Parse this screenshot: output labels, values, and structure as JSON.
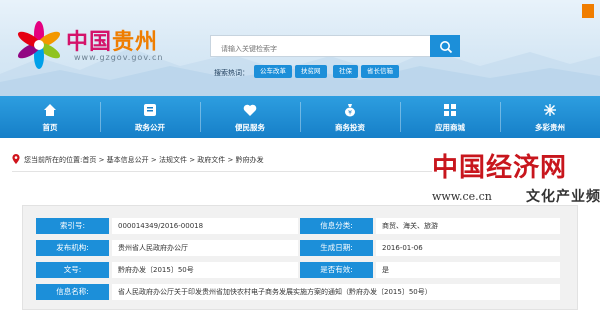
{
  "header": {
    "logo_text_1": "中国",
    "logo_text_2": "贵州",
    "logo_url": "www.gzgov.gov.cn",
    "search_placeholder": "请输入关键检索字",
    "hot_label": "搜索热词：",
    "hot_words": [
      "公车改革",
      "扶贫网",
      "社保",
      "省长信箱"
    ]
  },
  "nav": {
    "items": [
      {
        "label": "首页",
        "icon": "home-icon"
      },
      {
        "label": "政务公开",
        "icon": "government-icon"
      },
      {
        "label": "便民服务",
        "icon": "service-icon"
      },
      {
        "label": "商务投资",
        "icon": "money-bag-icon"
      },
      {
        "label": "应用商城",
        "icon": "store-icon"
      },
      {
        "label": "多彩贵州",
        "icon": "colorful-guizhou-icon"
      }
    ]
  },
  "breadcrumb": {
    "text": "您当前所在的位置:首页 > 基本信息公开 > 法规文件 > 政府文件 > 黔府办发"
  },
  "watermark": {
    "line1": "中国经济网",
    "line2": "www.ce.cn",
    "line3": "文化产业频道"
  },
  "info": {
    "index_label": "索引号:",
    "index_value": "000014349/2016-00018",
    "category_label": "信息分类:",
    "category_value": "商贸、海关、旅游",
    "publisher_label": "发布机构:",
    "publisher_value": "贵州省人民政府办公厅",
    "date_label": "生成日期:",
    "date_value": "2016-01-06",
    "docno_label": "文号:",
    "docno_value": "黔府办发〔2015〕50号",
    "valid_label": "是否有效:",
    "valid_value": "是",
    "name_label": "信息名称:",
    "name_value": "省人民政府办公厅关于印发贵州省加快农村电子商务发展实施方案的通知（黔府办发〔2015〕50号）"
  },
  "colors": {
    "accent": "#1c8fd9",
    "nav": "#167fc8",
    "watermark_red": "#c8161d"
  }
}
